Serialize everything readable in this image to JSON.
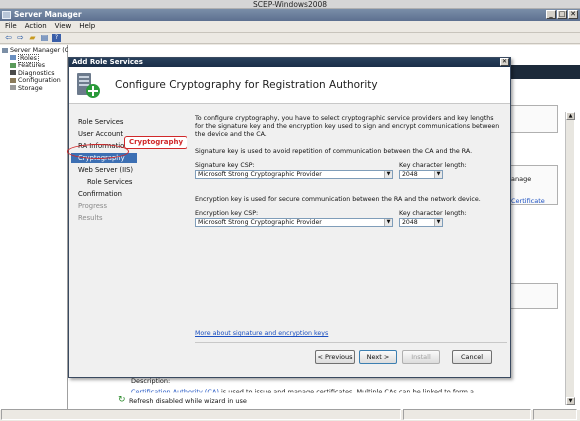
{
  "vm_title": "SCEP-Windows2008",
  "app": {
    "title": "Server Manager",
    "menu": [
      "File",
      "Action",
      "View",
      "Help"
    ],
    "toolbar_icons": [
      "back-arrow-icon",
      "forward-arrow-icon",
      "up-folder-icon",
      "show-hide-tree-icon",
      "help-icon"
    ]
  },
  "tree": {
    "root": "Server Manager (C",
    "items": [
      "Roles",
      "Features",
      "Diagnostics",
      "Configuration",
      "Storage"
    ]
  },
  "background": {
    "right_text_1": "anage",
    "right_link": "Certificate",
    "description_label": "Description:",
    "description_link": "Certification Authority (CA)",
    "description_text": " is used to issue and manage certificates. Multiple CAs can be linked to form a",
    "status_text": "Refresh disabled while wizard in use"
  },
  "wizard": {
    "title": "Add Role Services",
    "header": "Configure Cryptography for Registration Authority",
    "steps": [
      {
        "label": "Role Services",
        "state": "normal"
      },
      {
        "label": "User Account",
        "state": "normal"
      },
      {
        "label": "RA Information",
        "state": "normal"
      },
      {
        "label": "Cryptography",
        "state": "selected"
      },
      {
        "label": "Web Server (IIS)",
        "state": "normal"
      },
      {
        "label": "Role Services",
        "state": "normal"
      },
      {
        "label": "Confirmation",
        "state": "normal"
      },
      {
        "label": "Progress",
        "state": "disabled"
      },
      {
        "label": "Results",
        "state": "disabled"
      }
    ],
    "callout": "Cryptography",
    "intro": "To configure cryptography, you have to select cryptographic service providers and key lengths for the signature key and the encryption key used to sign and encrypt communications between the device and the CA.",
    "signature": {
      "description": "Signature key is used to avoid repetition of communication between the CA and the RA.",
      "csp_label": "Signature key CSP:",
      "csp_value": "Microsoft Strong Cryptographic Provider",
      "length_label": "Key character length:",
      "length_value": "2048"
    },
    "encryption": {
      "description": "Encryption key is used for secure communication between the RA and the network device.",
      "csp_label": "Encryption key CSP:",
      "csp_value": "Microsoft Strong Cryptographic Provider",
      "length_label": "Key character length:",
      "length_value": "2048"
    },
    "more_link": "More about signature and encryption keys",
    "buttons": {
      "previous": "< Previous",
      "next": "Next >",
      "install": "Install",
      "cancel": "Cancel"
    }
  },
  "colors": {
    "callout_red": "#d0282a",
    "selected_step": "#3c6fb3",
    "link_blue": "#1a4fc0"
  }
}
